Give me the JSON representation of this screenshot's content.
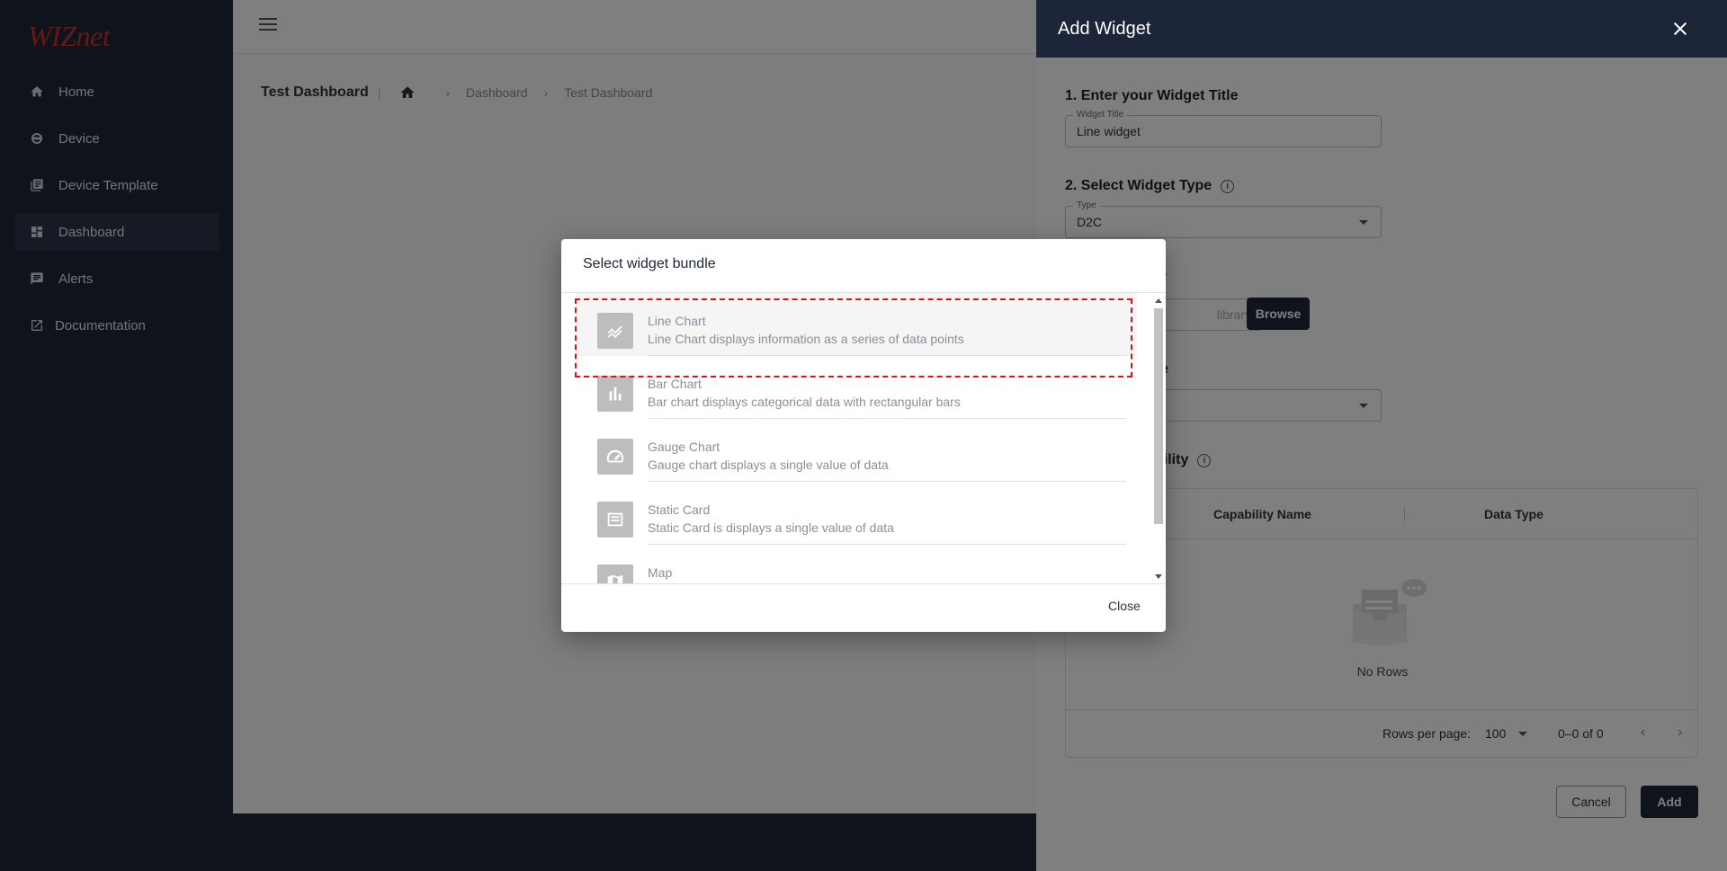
{
  "sidebar": {
    "logo": "WIZnet",
    "items": [
      {
        "label": "Home",
        "icon": "home-icon"
      },
      {
        "label": "Device",
        "icon": "device-icon"
      },
      {
        "label": "Device Template",
        "icon": "template-icon"
      },
      {
        "label": "Dashboard",
        "icon": "dashboard-icon",
        "active": true
      },
      {
        "label": "Alerts",
        "icon": "alerts-icon"
      },
      {
        "label": "Documentation",
        "icon": "external-link-icon"
      }
    ]
  },
  "breadcrumb": {
    "title": "Test Dashboard",
    "crumbs": [
      "Dashboard",
      "Test Dashboard"
    ]
  },
  "drawer": {
    "title": "Add Widget",
    "step1": "1. Enter your Widget Title",
    "widget_title_label": "Widget Title",
    "widget_title_value": "Line widget",
    "step2": "2. Select Widget Type",
    "type_label": "Type",
    "type_value": "D2C",
    "step3_partial": "ry",
    "library_placeholder": "library",
    "browse": "Browse",
    "step4_partial": "e",
    "step5_partial": "bility",
    "grid": {
      "col1": "Capability Name",
      "col2": "Data Type",
      "empty": "No Rows",
      "rows_per_page_label": "Rows per page:",
      "rows_per_page_value": "100",
      "range": "0–0 of 0"
    },
    "cancel": "Cancel",
    "add": "Add"
  },
  "modal": {
    "title": "Select widget bundle",
    "items": [
      {
        "name": "Line Chart",
        "desc": "Line Chart displays information as a series of data points",
        "icon": "line-chart-icon"
      },
      {
        "name": "Bar Chart",
        "desc": "Bar chart displays categorical data with rectangular bars",
        "icon": "bar-chart-icon"
      },
      {
        "name": "Gauge Chart",
        "desc": "Gauge chart displays a single value of data",
        "icon": "gauge-icon"
      },
      {
        "name": "Static Card",
        "desc": "Static Card is displays a single value of data",
        "icon": "card-icon"
      },
      {
        "name": "Map",
        "desc": "",
        "icon": "map-icon"
      }
    ],
    "close": "Close"
  },
  "colors": {
    "navy": "#1c2638",
    "highlight": "#e0101a"
  }
}
